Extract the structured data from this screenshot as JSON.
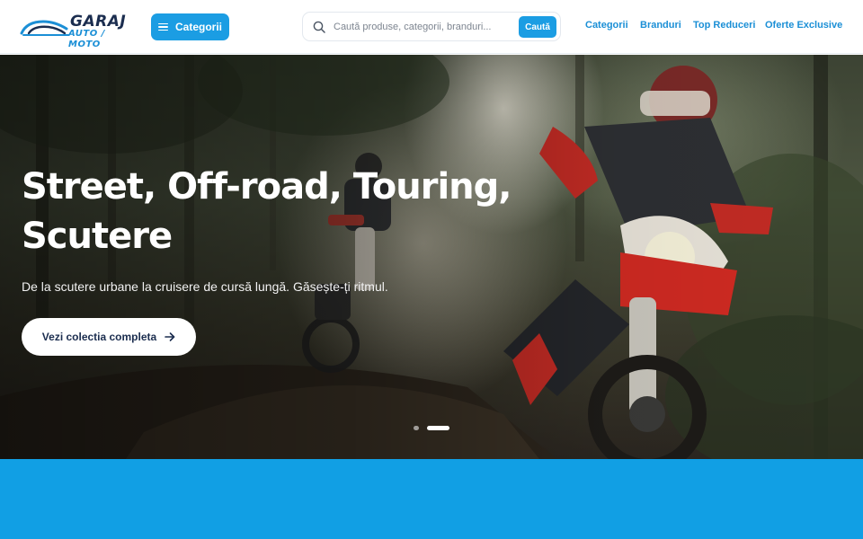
{
  "header": {
    "logo": {
      "line1": "GARAJ",
      "line2": "AUTO / MOTO"
    },
    "categories_button": {
      "label": "Categorii",
      "icon": "menu-icon"
    },
    "search": {
      "placeholder": "Caută produse, categorii, branduri...",
      "button_label": "Caută",
      "icon": "search-icon"
    },
    "nav": [
      {
        "label": "Categorii"
      },
      {
        "label": "Branduri"
      },
      {
        "label": "Top Reduceri"
      },
      {
        "label": "Oferte Exclusive"
      }
    ]
  },
  "hero": {
    "title": "Street, Off-road, Touring, Scutere",
    "subtitle": "De la scutere urbane la cruisere de cursă lungă. Găsește-ți ritmul.",
    "cta_label": "Vezi colectia completa",
    "cta_icon": "arrow-right-icon",
    "slides": {
      "total": 2,
      "active": 2
    }
  },
  "colors": {
    "accent": "#1b9de3",
    "brand_dark": "#1b2d4f",
    "band": "#119fe4"
  }
}
